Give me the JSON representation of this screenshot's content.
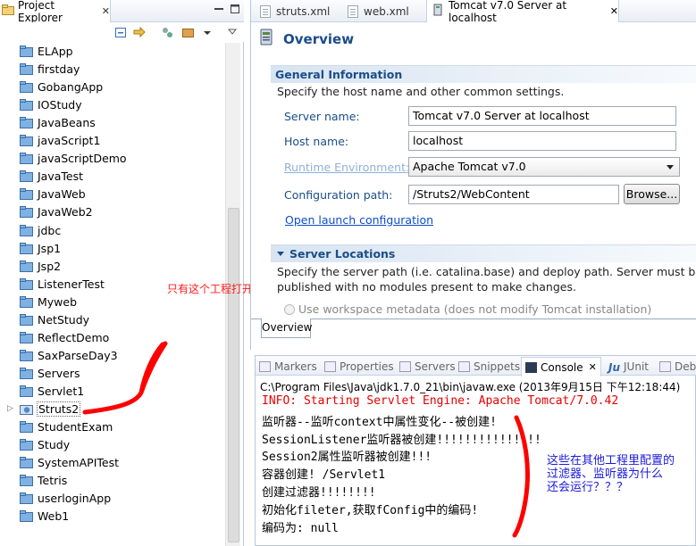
{
  "project_explorer": {
    "tab_label": "Project Explorer",
    "close_glyph": "✕",
    "projects": [
      {
        "name": "ELApp"
      },
      {
        "name": "firstday"
      },
      {
        "name": "GobangApp"
      },
      {
        "name": "IOStudy"
      },
      {
        "name": "JavaBeans"
      },
      {
        "name": "javaScript1"
      },
      {
        "name": "javaScriptDemo"
      },
      {
        "name": "JavaTest"
      },
      {
        "name": "JavaWeb"
      },
      {
        "name": "JavaWeb2"
      },
      {
        "name": "jdbc"
      },
      {
        "name": "Jsp1"
      },
      {
        "name": "Jsp2"
      },
      {
        "name": "ListenerTest"
      },
      {
        "name": "Myweb"
      },
      {
        "name": "NetStudy"
      },
      {
        "name": "ReflectDemo"
      },
      {
        "name": "SaxParseDay3"
      },
      {
        "name": "Servers"
      },
      {
        "name": "Servlet1"
      },
      {
        "name": "Struts2",
        "open": true
      },
      {
        "name": "StudentExam"
      },
      {
        "name": "Study"
      },
      {
        "name": "SystemAPITest"
      },
      {
        "name": "Tetris"
      },
      {
        "name": "userloginApp"
      },
      {
        "name": "Web1"
      }
    ],
    "annotation": "只有这个工程打开了"
  },
  "editor": {
    "tabs": [
      {
        "label": "struts.xml",
        "active": false
      },
      {
        "label": "web.xml",
        "active": false
      },
      {
        "label": "Tomcat v7.0 Server at localhost",
        "active": true
      }
    ],
    "close_glyph": "✕",
    "overview_title": "Overview",
    "general_info": {
      "title": "General Information",
      "description": "Specify the host name and other common settings.",
      "server_name_label": "Server name:",
      "server_name_value": "Tomcat v7.0 Server at localhost",
      "host_name_label": "Host name:",
      "host_name_value": "localhost",
      "runtime_label": "Runtime Environment:",
      "runtime_value": "Apache Tomcat v7.0",
      "config_path_label": "Configuration path:",
      "config_path_value": "/Struts2/WebContent",
      "browse_label": "Browse...",
      "open_launch_link": "Open launch configuration"
    },
    "server_locations": {
      "title": "Server Locations",
      "desc_line1": "Specify the server path (i.e. catalina.base) and deploy path. Server must be",
      "desc_line2": "published with no modules present to make changes.",
      "option_workspace": "Use workspace metadata (does not modify Tomcat installation)"
    },
    "bottom_tab": "Overview"
  },
  "console": {
    "tabs": [
      {
        "label": "Markers"
      },
      {
        "label": "Properties"
      },
      {
        "label": "Servers"
      },
      {
        "label": "Snippets"
      },
      {
        "label": "Console",
        "active": true
      },
      {
        "label": "JUnit"
      },
      {
        "label": "Debu"
      }
    ],
    "launch_path": "C:\\Program Files\\Java\\jdk1.7.0_21\\bin\\javaw.exe (2013年9月15日 下午12:18:44)",
    "lines": [
      {
        "text": "INFO: Starting Servlet Engine: Apache Tomcat/7.0.42",
        "error": true
      },
      {
        "text": "监听器--监听context中属性变化--被创建!"
      },
      {
        "text": "SessionListener监听器被创建!!!!!!!!!!!!!!!"
      },
      {
        "text": "Session2属性监听器被创建!!!"
      },
      {
        "text": "容器创建! /Servlet1"
      },
      {
        "text": "创建过滤器!!!!!!!!"
      },
      {
        "text": "初始化fileter,获取fConfig中的编码!"
      },
      {
        "text": "编码为: null"
      }
    ],
    "annotation_lines": [
      "这些在其他工程里配置的",
      "过滤器、监听器为什么",
      "还会运行？？？"
    ]
  },
  "colors": {
    "accent_blue": "#1a4d88",
    "annotation_red": "#ff1a1a",
    "annotation_blue": "#1a1ad9",
    "console_error": "#e60000"
  }
}
